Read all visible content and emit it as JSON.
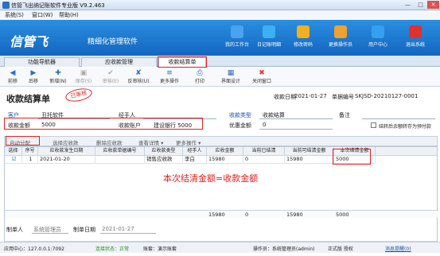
{
  "window": {
    "title": "信管飞出纳记账软件专业版 V9.2.463"
  },
  "menu": [
    "系统(S)",
    "窗口(W)",
    "帮助(H)"
  ],
  "banner": {
    "logo": "信管飞",
    "slogan": "精细化管理软件",
    "nav": [
      {
        "label": "我的工作台",
        "icon": "desktop-icon",
        "color": "#4aa3f0"
      },
      {
        "label": "日记账明细",
        "icon": "ledger-icon",
        "color": "#3cb0f5"
      },
      {
        "label": "修改密码",
        "icon": "key-icon",
        "color": "#f0b020"
      },
      {
        "label": "更换操作员",
        "icon": "user-icon",
        "color": "#f0a030"
      },
      {
        "label": "用户中心",
        "icon": "person-icon",
        "color": "#35a0ee"
      },
      {
        "label": "退出系统",
        "icon": "power-icon",
        "color": "#e03030"
      }
    ]
  },
  "tabs": [
    "功能导航器",
    "应收款管理",
    "收款结算单"
  ],
  "toolbar": [
    {
      "label": "前移",
      "icon": "left-arrow-icon",
      "g": "◀",
      "dis": false
    },
    {
      "label": "后移",
      "icon": "right-arrow-icon",
      "g": "▶",
      "dis": false
    },
    {
      "label": "新增(N)",
      "icon": "add-icon",
      "g": "✚",
      "dis": false
    },
    {
      "label": "保存(S)",
      "icon": "save-icon",
      "g": "▣",
      "dis": true
    },
    {
      "label": "审核(E)",
      "icon": "check-icon",
      "g": "✔",
      "dis": true
    },
    {
      "label": "反审核(U)",
      "icon": "uncheck-icon",
      "g": "✘",
      "dis": false
    },
    {
      "label": "更多操作",
      "icon": "more-icon",
      "g": "≡",
      "dis": false
    },
    {
      "label": "打印",
      "icon": "print-icon",
      "g": "⎙",
      "dis": false
    },
    {
      "label": "界面设计",
      "icon": "design-icon",
      "g": "▦",
      "dis": false
    },
    {
      "label": "关闭窗口",
      "icon": "close-icon",
      "g": "✖",
      "dis": false
    }
  ],
  "header": {
    "title": "收款结算单",
    "stamp": "已审核",
    "date_label": "收款日期",
    "date": "2021-01-27",
    "no_label": "单据编号",
    "no": "SKJSD-20210127-0001"
  },
  "form": {
    "customer_label": "客户",
    "customer": "丑托软件",
    "handler_label": "经手人",
    "handler": "",
    "type_label": "收款类型",
    "type": "收款结算",
    "remark_label": "备注",
    "remark": "",
    "amount_label": "收款金额",
    "amount": "5000",
    "account_label": "收款账户",
    "account": "建设银行 5000",
    "discount_label": "优惠金额",
    "discount": "0",
    "prepay_label": "结转后余额转存为预付款"
  },
  "gridtb": [
    "自动分配",
    "选择应收款",
    "删除应收款",
    "查看详情 ▾",
    "更多操作 ▾"
  ],
  "grid": {
    "headers": [
      "选择",
      "序号",
      "应收款发生日期",
      "应收款单据编号",
      "应收款类型",
      "经手人",
      "应收金额",
      "当前已结清",
      "当前可结清金额",
      "本次结清金额"
    ],
    "rows": [
      [
        "☑",
        "1",
        "2021-01-20",
        "",
        "销售应收款",
        "李白",
        "15980",
        "0",
        "15980",
        "5000"
      ]
    ],
    "sum": [
      "15980",
      "0",
      "15980",
      "5000"
    ]
  },
  "note": "本次结清金额=收款金额",
  "footer": {
    "maker_label": "制单人",
    "maker": "系统管理员",
    "date_label": "制单日期",
    "date": "2021-01-27"
  },
  "status": [
    "应用中心：127.0.0.1:7092",
    "连接状态：正常",
    "账套：演示账套",
    "操作员：系统管理员(admin)",
    "正式版 授权",
    "消息提醒(0)"
  ]
}
